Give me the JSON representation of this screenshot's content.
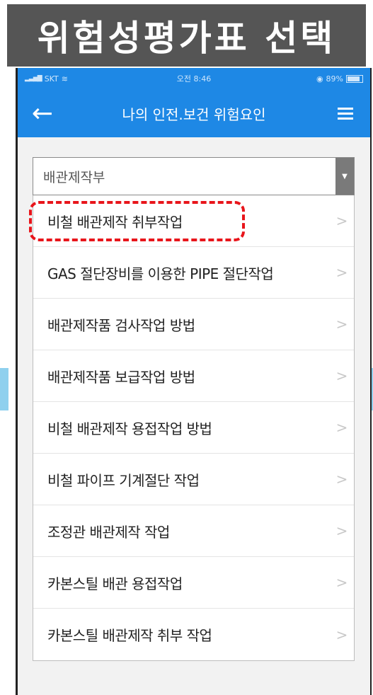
{
  "banner": {
    "title": "위험성평가표 선택"
  },
  "statusbar": {
    "carrier": "SKT",
    "time": "오전 8:46",
    "battery": "89%"
  },
  "appbar": {
    "title": "나의 인전.보건 위험요인"
  },
  "select": {
    "value": "배관제작부"
  },
  "list": {
    "items": [
      {
        "label": "비철 배관제작 취부작업",
        "highlighted": true
      },
      {
        "label": "GAS 절단장비를 이용한 PIPE 절단작업"
      },
      {
        "label": "배관제작품 검사작업 방법"
      },
      {
        "label": "배관제작품 보급작업 방법"
      },
      {
        "label": "비철 배관제작 용접작업 방법"
      },
      {
        "label": "비철 파이프 기계절단 작업"
      },
      {
        "label": "조정관 배관제작 작업"
      },
      {
        "label": "카본스틸 배관 용접작업"
      },
      {
        "label": "카본스틸 배관제작 취부 작업"
      }
    ],
    "chevron": ">"
  },
  "colors": {
    "appbar": "#1e88e5",
    "highlight": "#e8151b",
    "banner": "#555555"
  }
}
